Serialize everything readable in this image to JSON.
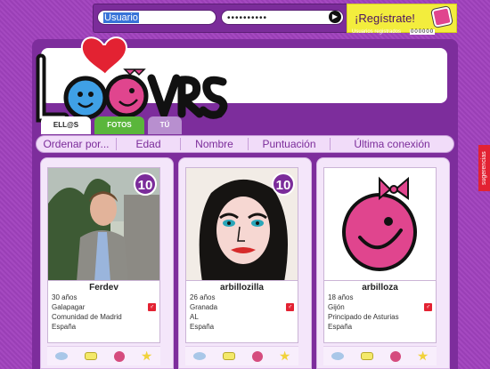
{
  "topbar": {
    "username_value": "Usuario",
    "password_value": "••••••••••",
    "go_symbol": "▶",
    "register_label": "¡Regístrate!",
    "registered_label": "Usuarios registrados",
    "registered_count": "000000"
  },
  "logo": {
    "text": "LOOVRS",
    "brand_pink": "#e0458e",
    "brand_blue": "#3fa0e6",
    "heart_red": "#e32232"
  },
  "tabs": [
    {
      "label": "ELL@S"
    },
    {
      "label": "FOTOS"
    },
    {
      "label": "TÚ"
    }
  ],
  "sort": {
    "items": [
      "Ordenar por...",
      "Edad",
      "Nombre",
      "Puntuación",
      "Última conexión"
    ]
  },
  "profiles": [
    {
      "name": "Ferdev",
      "age": "30 años",
      "city": "Galapagar",
      "region": "Comunidad de Madrid",
      "country": "España",
      "score": "10",
      "photo": "man-photo"
    },
    {
      "name": "arbillozilla",
      "age": "26 años",
      "city": "Granada",
      "region": "AL",
      "country": "España",
      "score": "10",
      "photo": "popart-woman-photo"
    },
    {
      "name": "arbilloza",
      "age": "18 años",
      "city": "Gijón",
      "region": "Principado de Asturias",
      "country": "España",
      "score": "",
      "photo": "pink-blob-avatar"
    }
  ],
  "suggestions_label": "sugerencias",
  "colors": {
    "accent_purple": "#7b2c9a",
    "card_bg": "#f4e6fa",
    "yellow": "#f3ed3d",
    "green": "#5ab63b"
  }
}
